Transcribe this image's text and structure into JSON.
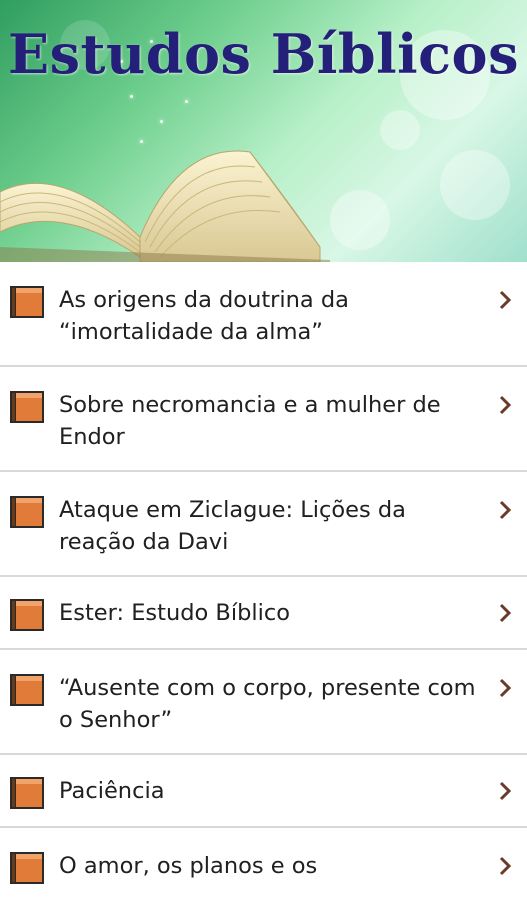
{
  "header": {
    "title": "Estudos Bíblicos",
    "gradient_colors": [
      "#2f9e5f",
      "#b7f0c8",
      "#9fe0cc"
    ],
    "title_color": "#24207a"
  },
  "list": {
    "items": [
      {
        "label": "As origens da doutrina da “imortalidade da alma”",
        "icon": "book-icon"
      },
      {
        "label": "Sobre necromancia e a mulher de Endor",
        "icon": "book-icon"
      },
      {
        "label": "Ataque em Ziclague: Lições da reação da Davi",
        "icon": "book-icon"
      },
      {
        "label": "Ester: Estudo Bíblico",
        "icon": "book-icon"
      },
      {
        "label": "“Ausente com o corpo, presente com o Senhor”",
        "icon": "book-icon"
      },
      {
        "label": "Paciência",
        "icon": "book-icon"
      },
      {
        "label": "O amor, os planos e os",
        "icon": "book-icon"
      }
    ],
    "chevron_color": "#6b3b2a",
    "divider_color": "#d9d9d9",
    "book_icon_color": "#e07b39"
  }
}
